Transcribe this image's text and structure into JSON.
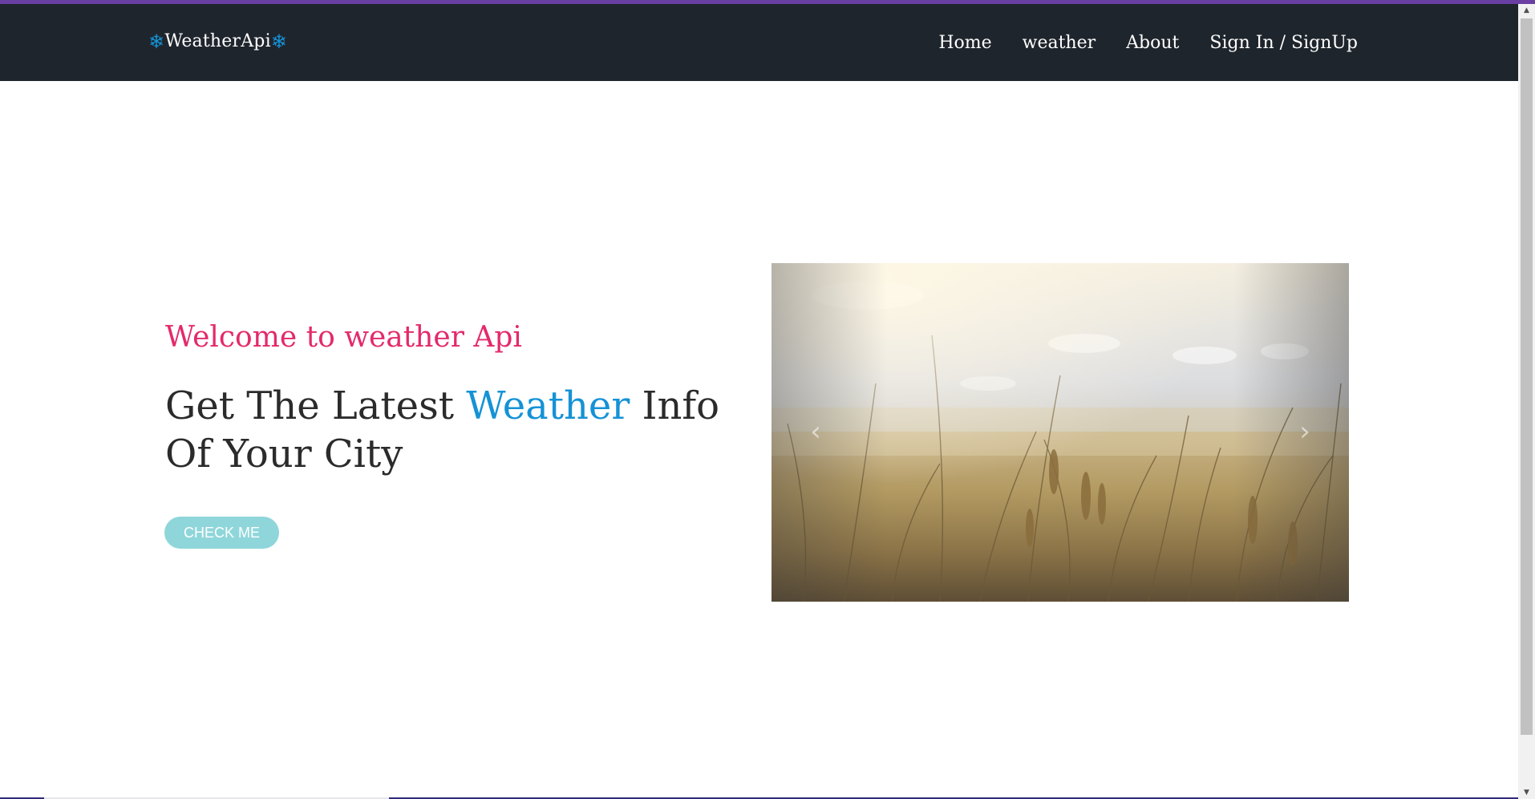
{
  "brand": {
    "name": "WeatherApi",
    "icon_left": "snowflake-icon",
    "icon_right": "snowflake-icon",
    "flake_glyph": "❄"
  },
  "nav": {
    "items": [
      {
        "label": "Home"
      },
      {
        "label": "weather"
      },
      {
        "label": "About"
      },
      {
        "label": "Sign In / SignUp"
      }
    ]
  },
  "hero": {
    "welcome": "Welcome to weather Api",
    "headline_part1": "Get The Latest ",
    "headline_accent": "Weather",
    "headline_part2": " Info Of Your City",
    "button_label": "CHECK ME"
  },
  "carousel": {
    "image": "wheat-field-photo",
    "prev_icon": "chevron-left-icon",
    "next_icon": "chevron-right-icon",
    "prev_glyph": "‹",
    "next_glyph": "›"
  },
  "colors": {
    "navbar": "#1f252d",
    "accent_blue": "#1592d6",
    "welcome_pink": "#e32a6b",
    "button_teal": "#8fd6da",
    "top_accent": "#6a3fa3"
  }
}
